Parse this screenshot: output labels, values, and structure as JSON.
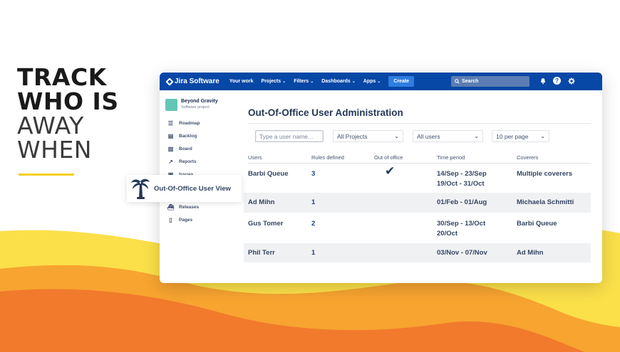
{
  "headline": {
    "line1": "TRACK",
    "line2": "WHO IS",
    "line3": "AWAY",
    "line4": "WHEN"
  },
  "topbar": {
    "brand": "Jira Software",
    "nav": [
      {
        "label": "Your work",
        "has_chevron": false
      },
      {
        "label": "Projects",
        "has_chevron": true
      },
      {
        "label": "Filters",
        "has_chevron": true
      },
      {
        "label": "Dashboards",
        "has_chevron": true
      },
      {
        "label": "Apps",
        "has_chevron": true
      }
    ],
    "create_label": "Create",
    "search_placeholder": "Search",
    "icons": [
      "bell-icon",
      "help-icon",
      "settings-icon"
    ]
  },
  "sidebar": {
    "project_name": "Beyond Gravity",
    "project_type": "Software project",
    "items": [
      {
        "label": "Roadmap",
        "icon": "roadmap-icon"
      },
      {
        "label": "Backlog",
        "icon": "backlog-icon"
      },
      {
        "label": "Board",
        "icon": "board-icon"
      },
      {
        "label": "Reports",
        "icon": "reports-icon"
      },
      {
        "label": "Issues",
        "icon": "issues-icon"
      },
      {
        "label": "Releases",
        "icon": "releases-icon"
      },
      {
        "label": "Pages",
        "icon": "pages-icon"
      }
    ],
    "highlight_label": "Out-Of-Office User View"
  },
  "main": {
    "title": "Out-Of-Office User Administration",
    "filters": {
      "user_placeholder": "Type a user name...",
      "project_select": "All Projects",
      "users_select": "All users",
      "page_size_select": "10 per page"
    },
    "columns": [
      "Users",
      "Rules defined",
      "Out of office",
      "Time period",
      "Coverers"
    ],
    "rows": [
      {
        "user": "Barbi Queue",
        "rules": "3",
        "out_of_office": "✔",
        "period_line1": "14/Sep - 23/Sep",
        "period_line2": "19/Oct - 31/Oct",
        "coverers": "Multiple coverers"
      },
      {
        "user": "Ad Mihn",
        "rules": "1",
        "out_of_office": "",
        "period_line1": "01/Feb - 01/Aug",
        "period_line2": "",
        "coverers": "Michaela Schmitti"
      },
      {
        "user": "Gus Tomer",
        "rules": "2",
        "out_of_office": "",
        "period_line1": "30/Sep - 13/Oct",
        "period_line2": "20/Oct",
        "coverers": "Barbi Queue"
      },
      {
        "user": "Phil Terr",
        "rules": "1",
        "out_of_office": "",
        "period_line1": "03/Nov - 07/Nov",
        "period_line2": "",
        "coverers": "Ad Mihn"
      }
    ]
  },
  "colors": {
    "topbar": "#0747a6",
    "accent_yellow": "#f5cf1e",
    "accent_orange": "#f08a2c",
    "link": "#1f3c88"
  }
}
